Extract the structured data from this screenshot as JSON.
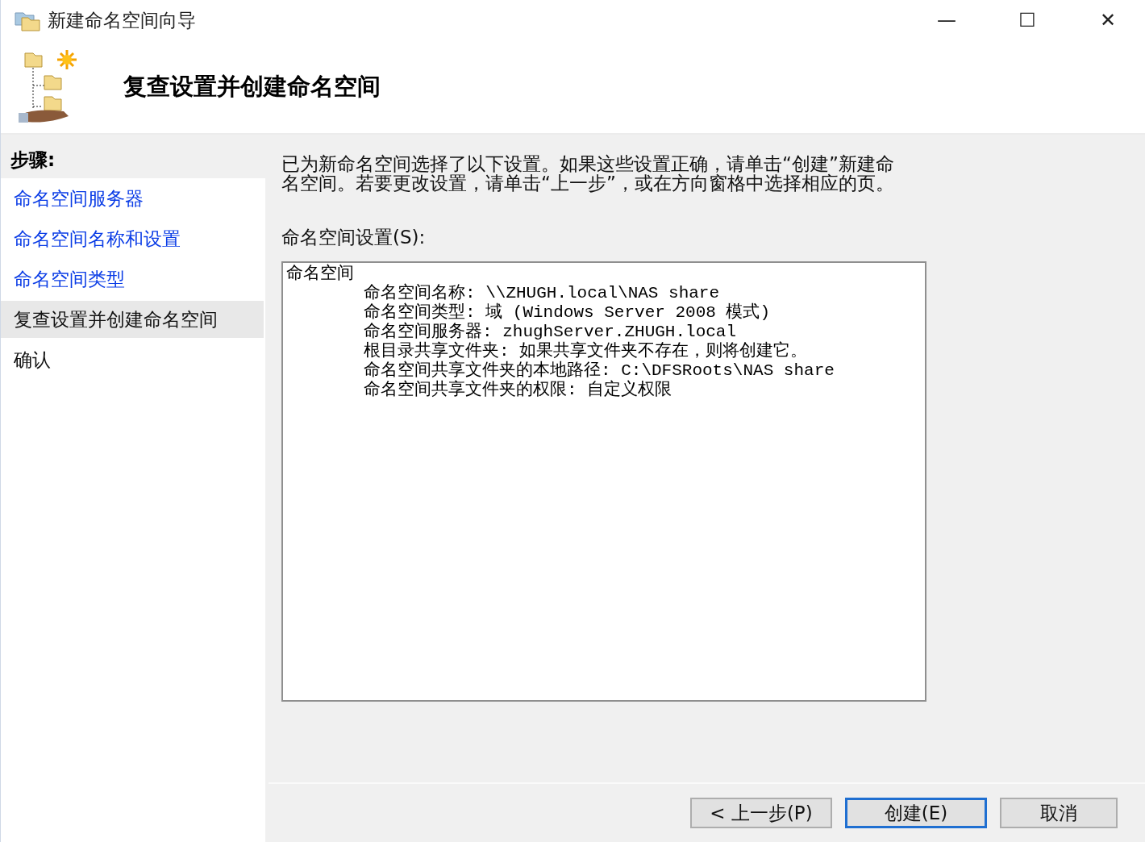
{
  "window": {
    "title": "新建命名空间向导",
    "controls": [
      "—",
      "☐",
      "✕"
    ]
  },
  "header": {
    "title": "复查设置并创建命名空间"
  },
  "sidebar": {
    "title": "步骤:",
    "items": [
      {
        "label": "命名空间服务器",
        "link": true,
        "selected": false
      },
      {
        "label": "命名空间名称和设置",
        "link": true,
        "selected": false
      },
      {
        "label": "命名空间类型",
        "link": true,
        "selected": false
      },
      {
        "label": "复查设置并创建命名空间",
        "link": false,
        "selected": true
      },
      {
        "label": "确认",
        "link": false,
        "selected": false
      }
    ]
  },
  "content": {
    "description": "已为新命名空间选择了以下设置。如果这些设置正确，请单击“创建”新建命名空间。若要更改设置，请单击“上一步”，或在方向窗格中选择相应的页。",
    "settings_label": "命名空间设置(S):",
    "settings": {
      "heading": "命名空间",
      "lines": [
        "命名空间名称: \\\\ZHUGH.local\\NAS share",
        "命名空间类型: 域 (Windows Server 2008 模式)",
        "命名空间服务器: zhughServer.ZHUGH.local",
        "根目录共享文件夹: 如果共享文件夹不存在，则将创建它。",
        "命名空间共享文件夹的本地路径: C:\\DFSRoots\\NAS share",
        "命名空间共享文件夹的权限: 自定义权限"
      ]
    }
  },
  "buttons": [
    {
      "label": "< 上一步(P)",
      "default": false
    },
    {
      "label": "创建(E)",
      "default": true
    },
    {
      "label": "取消",
      "default": false
    }
  ]
}
